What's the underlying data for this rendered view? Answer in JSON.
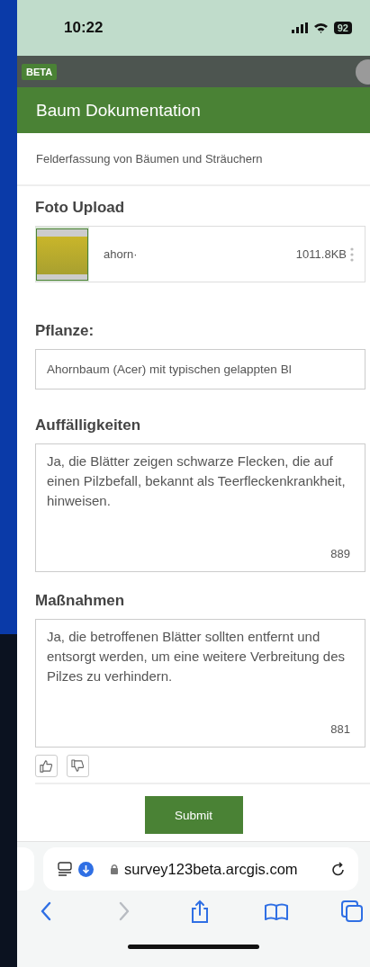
{
  "status_bar": {
    "time": "10:22",
    "battery": "92"
  },
  "app_bar": {
    "badge": "BETA"
  },
  "form": {
    "title": "Baum Dokumentation",
    "description": "Felderfassung von Bäumen und Sträuchern",
    "photo_upload": {
      "label": "Foto Upload",
      "file_name": "ahorn·",
      "file_size": "1011.8KB"
    },
    "questions": [
      {
        "kind": "text",
        "label": "Pflanze:",
        "value": "Ahornbaum (Acer) mit typischen gelappten Bl"
      },
      {
        "kind": "textarea",
        "label": "Auffälligkeiten",
        "value": "Ja, die Blätter zeigen schwarze Flecken, die auf einen Pilzbefall, bekannt als Teerfleckenkrankheit, hinweisen.",
        "counter": "889"
      },
      {
        "kind": "textarea",
        "label": "Maßnahmen",
        "value": "Ja, die betroffenen Blätter sollten entfernt und entsorgt werden, um eine weitere Verbreitung des Pilzes zu verhindern.",
        "counter": "881"
      }
    ],
    "submit": "Submit"
  },
  "browser": {
    "url": "survey123beta.arcgis.com",
    "nav": [
      {
        "kind": "back",
        "disabled": false
      },
      {
        "kind": "forward",
        "disabled": true
      },
      {
        "kind": "share",
        "disabled": false
      },
      {
        "kind": "bookmarks",
        "disabled": false
      },
      {
        "kind": "tabs",
        "disabled": false
      }
    ]
  }
}
